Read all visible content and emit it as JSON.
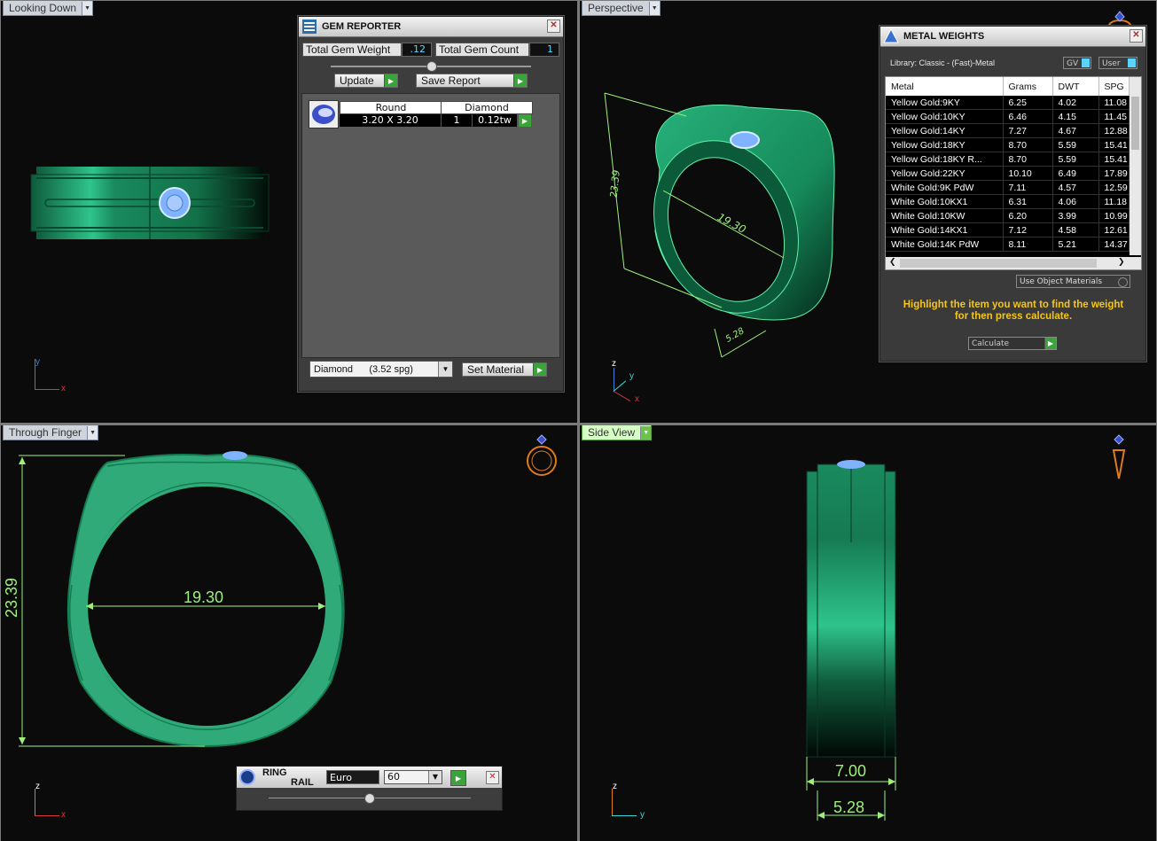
{
  "viewports": {
    "top_left": {
      "label": "Looking Down"
    },
    "top_right": {
      "label": "Perspective"
    },
    "bottom_left": {
      "label": "Through Finger"
    },
    "bottom_right": {
      "label": "Side View"
    }
  },
  "axes": {
    "tl": {
      "a": "y",
      "b": "x"
    },
    "tr": {
      "a": "z",
      "b": "y",
      "c": "x"
    },
    "bl": {
      "a": "z",
      "b": "x"
    },
    "br": {
      "a": "z",
      "b": "y"
    }
  },
  "dimensions": {
    "persp_height": "23.39",
    "persp_inner": "19.30",
    "persp_width": "5.28",
    "finger_height": "23.39",
    "finger_inner": "19.30",
    "side_top": "7.00",
    "side_bottom": "5.28"
  },
  "gem_reporter": {
    "title": "GEM REPORTER",
    "total_weight_label": "Total Gem Weight",
    "total_weight_value": ".12",
    "total_count_label": "Total Gem Count",
    "total_count_value": "1",
    "update_label": "Update",
    "save_report_label": "Save Report",
    "row": {
      "shape": "Round",
      "type": "Diamond",
      "size": "3.20 X 3.20",
      "count": "1",
      "weight": "0.12tw"
    },
    "material_value": "Diamond      (3.52 spg)",
    "set_material_label": "Set Material"
  },
  "metal_weights": {
    "title": "METAL WEIGHTS",
    "library": "Library: Classic - (Fast)-Metal",
    "gv_label": "GV",
    "user_label": "User",
    "columns": [
      "Metal",
      "Grams",
      "DWT",
      "SPG"
    ],
    "rows": [
      [
        "Yellow Gold:9KY",
        "6.25",
        "4.02",
        "11.08"
      ],
      [
        "Yellow Gold:10KY",
        "6.46",
        "4.15",
        "11.45"
      ],
      [
        "Yellow Gold:14KY",
        "7.27",
        "4.67",
        "12.88"
      ],
      [
        "Yellow Gold:18KY",
        "8.70",
        "5.59",
        "15.41"
      ],
      [
        "Yellow Gold:18KY R...",
        "8.70",
        "5.59",
        "15.41"
      ],
      [
        "Yellow Gold:22KY",
        "10.10",
        "6.49",
        "17.89"
      ],
      [
        "White Gold:9K PdW",
        "7.11",
        "4.57",
        "12.59"
      ],
      [
        "White Gold:10KX1",
        "6.31",
        "4.06",
        "11.18"
      ],
      [
        "White Gold:10KW",
        "6.20",
        "3.99",
        "10.99"
      ],
      [
        "White Gold:14KX1",
        "7.12",
        "4.58",
        "12.61"
      ],
      [
        "White Gold:14K PdW",
        "8.11",
        "5.21",
        "14.37"
      ]
    ],
    "use_object_materials": "Use Object Materials",
    "hint": "Highlight the item you want to find the weight for then press calculate.",
    "calculate_label": "Calculate"
  },
  "ring_rail": {
    "title_line1": "RING",
    "title_line2": "RAIL",
    "standard": "Euro",
    "size": "60"
  },
  "colors": {
    "ring_green": "#1f9a6a",
    "dim_green": "#9ef07a",
    "accent_orange": "#e07a1a",
    "gem_blue": "#7fb3ff"
  }
}
